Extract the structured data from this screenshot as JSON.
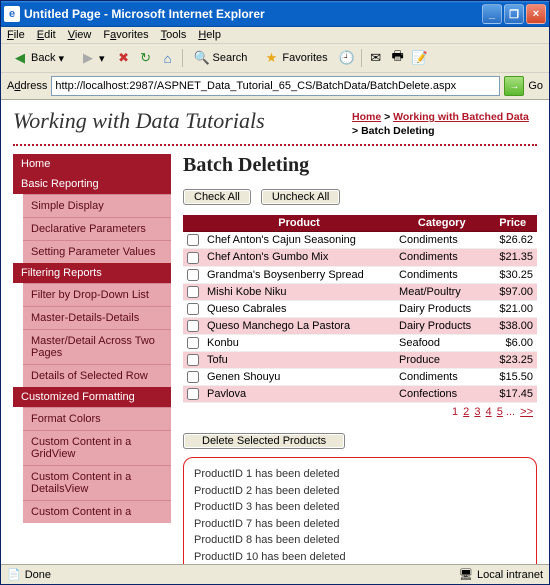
{
  "window": {
    "title": "Untitled Page - Microsoft Internet Explorer"
  },
  "menu": [
    "File",
    "Edit",
    "View",
    "Favorites",
    "Tools",
    "Help"
  ],
  "toolbar": {
    "back": "Back",
    "search": "Search",
    "favorites": "Favorites"
  },
  "address": {
    "label": "Address",
    "url": "http://localhost:2987/ASPNET_Data_Tutorial_65_CS/BatchData/BatchDelete.aspx",
    "go": "Go"
  },
  "header": {
    "title": "Working with Data Tutorials",
    "breadcrumb": {
      "home": "Home",
      "section": "Working with Batched Data",
      "current": "Batch Deleting",
      "sep": " > "
    }
  },
  "sidebar": [
    {
      "type": "head",
      "label": "Home"
    },
    {
      "type": "head",
      "label": "Basic Reporting"
    },
    {
      "type": "sub",
      "label": "Simple Display"
    },
    {
      "type": "sub",
      "label": "Declarative Parameters"
    },
    {
      "type": "sub",
      "label": "Setting Parameter Values"
    },
    {
      "type": "head",
      "label": "Filtering Reports"
    },
    {
      "type": "sub",
      "label": "Filter by Drop-Down List"
    },
    {
      "type": "sub",
      "label": "Master-Details-Details"
    },
    {
      "type": "sub",
      "label": "Master/Detail Across Two Pages"
    },
    {
      "type": "sub",
      "label": "Details of Selected Row"
    },
    {
      "type": "head",
      "label": "Customized Formatting"
    },
    {
      "type": "sub",
      "label": "Format Colors"
    },
    {
      "type": "sub",
      "label": "Custom Content in a GridView"
    },
    {
      "type": "sub",
      "label": "Custom Content in a DetailsView"
    },
    {
      "type": "sub",
      "label": "Custom Content in a"
    }
  ],
  "main": {
    "heading": "Batch Deleting",
    "check_all": "Check All",
    "uncheck_all": "Uncheck All",
    "columns": {
      "product": "Product",
      "category": "Category",
      "price": "Price"
    },
    "rows": [
      {
        "product": "Chef Anton's Cajun Seasoning",
        "category": "Condiments",
        "price": "$26.62"
      },
      {
        "product": "Chef Anton's Gumbo Mix",
        "category": "Condiments",
        "price": "$21.35"
      },
      {
        "product": "Grandma's Boysenberry Spread",
        "category": "Condiments",
        "price": "$30.25"
      },
      {
        "product": "Mishi Kobe Niku",
        "category": "Meat/Poultry",
        "price": "$97.00"
      },
      {
        "product": "Queso Cabrales",
        "category": "Dairy Products",
        "price": "$21.00"
      },
      {
        "product": "Queso Manchego La Pastora",
        "category": "Dairy Products",
        "price": "$38.00"
      },
      {
        "product": "Konbu",
        "category": "Seafood",
        "price": "$6.00"
      },
      {
        "product": "Tofu",
        "category": "Produce",
        "price": "$23.25"
      },
      {
        "product": "Genen Shouyu",
        "category": "Condiments",
        "price": "$15.50"
      },
      {
        "product": "Pavlova",
        "category": "Confections",
        "price": "$17.45"
      }
    ],
    "pager": {
      "current": "1",
      "pages": [
        "2",
        "3",
        "4",
        "5"
      ],
      "more": "...",
      "next": ">>"
    },
    "delete_btn": "Delete Selected Products",
    "messages": [
      "ProductID 1 has been deleted",
      "ProductID 2 has been deleted",
      "ProductID 3 has been deleted",
      "ProductID 7 has been deleted",
      "ProductID 8 has been deleted",
      "ProductID 10 has been deleted"
    ]
  },
  "status": {
    "left": "Done",
    "right": "Local intranet"
  }
}
